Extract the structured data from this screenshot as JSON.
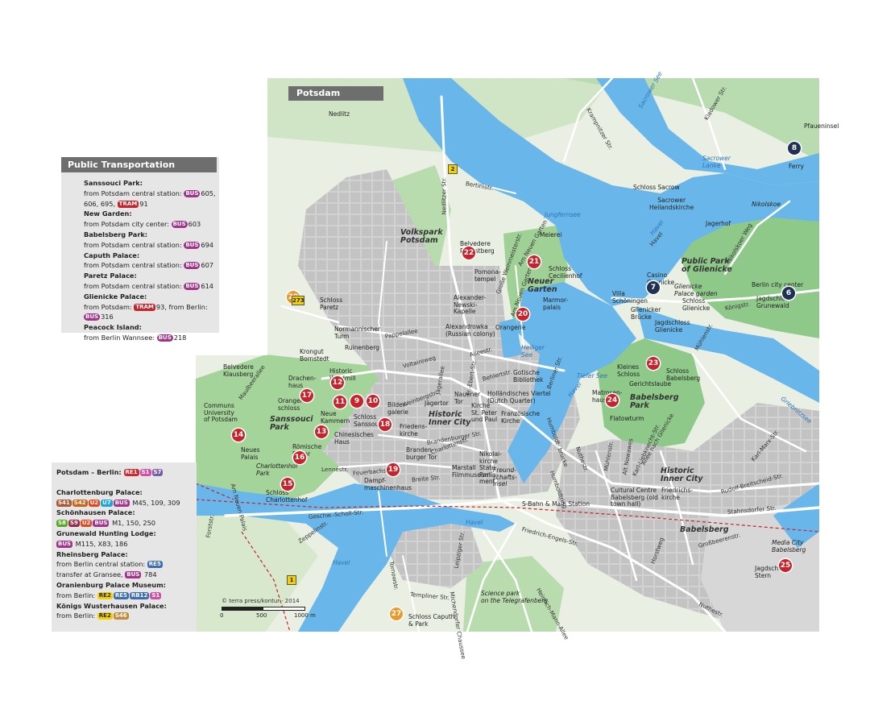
{
  "map_title": "Potsdam",
  "public_transport": {
    "header": "Public Transportation",
    "entries": [
      {
        "title": "Sanssouci Park:",
        "text": "from Potsdam central station:",
        "badges": [
          {
            "kind": "bus",
            "label": "BUS"
          }
        ],
        "routes": "605, 606, 695,",
        "badges2": [
          {
            "kind": "tram",
            "label": "TRAM"
          }
        ],
        "routes2": "91"
      },
      {
        "title": "New Garden:",
        "text": "from Potsdam city center:",
        "badges": [
          {
            "kind": "bus",
            "label": "BUS"
          }
        ],
        "routes": "603"
      },
      {
        "title": "Babelsberg Park:",
        "text": "from Potsdam central station:",
        "badges": [
          {
            "kind": "bus",
            "label": "BUS"
          }
        ],
        "routes": "694"
      },
      {
        "title": "Caputh Palace:",
        "text": "from Potsdam central station:",
        "badges": [
          {
            "kind": "bus",
            "label": "BUS"
          }
        ],
        "routes": "607"
      },
      {
        "title": "Paretz Palace:",
        "text": "from Potsdam central station:",
        "badges": [
          {
            "kind": "bus",
            "label": "BUS"
          }
        ],
        "routes": "614"
      },
      {
        "title": "Glienicke Palace:",
        "text": "from Potsdam:",
        "badges": [
          {
            "kind": "tram",
            "label": "TRAM"
          }
        ],
        "routes": "93, from Berlin:",
        "badges2": [
          {
            "kind": "bus",
            "label": "BUS"
          }
        ],
        "routes2": "316"
      },
      {
        "title": "Peacock Island:",
        "text": "from Berlin Wannsee:",
        "badges": [
          {
            "kind": "bus",
            "label": "BUS"
          }
        ],
        "routes": "218"
      }
    ]
  },
  "berlin_box": {
    "title": "Potsdam – Berlin:",
    "title_badges": [
      {
        "label": "RE1",
        "color": "#d7262e"
      },
      {
        "label": "S1",
        "color": "#d24fa8"
      },
      {
        "label": "S7",
        "color": "#7b5ca8"
      }
    ],
    "entries": [
      {
        "title": "Charlottenburg Palace:",
        "lines": [
          {
            "badges": [
              {
                "label": "S41",
                "color": "#ad5937"
              },
              {
                "label": "S42",
                "color": "#cb6418"
              },
              {
                "label": "U2",
                "color": "#e4461d"
              },
              {
                "label": "U7",
                "color": "#1ba5dc"
              },
              {
                "label": "BUS",
                "color": "#a3328a"
              }
            ],
            "text": "M45, 109, 309"
          }
        ]
      },
      {
        "title": "Schönhausen Palace:",
        "lines": [
          {
            "badges": [
              {
                "label": "S8",
                "color": "#55a822"
              },
              {
                "label": "S9",
                "color": "#992746"
              },
              {
                "label": "U2",
                "color": "#e4461d"
              },
              {
                "label": "BUS",
                "color": "#a3328a"
              }
            ],
            "text": "M1, 150, 250"
          }
        ]
      },
      {
        "title": "Grunewald Hunting Lodge:",
        "lines": [
          {
            "badges": [
              {
                "label": "BUS",
                "color": "#a3328a"
              }
            ],
            "text": "M115, X83, 186"
          }
        ]
      },
      {
        "title": "Rheinsberg Palace:",
        "lines": [
          {
            "badges": [],
            "text": "from Berlin central station:",
            "badges_after": [
              {
                "label": "RE5",
                "color": "#3b6bb3"
              }
            ]
          },
          {
            "badges": [],
            "text": "transfer at Gransee,",
            "badges_after": [
              {
                "label": "BUS",
                "color": "#a3328a"
              }
            ],
            "text_after": "784"
          }
        ]
      },
      {
        "title": "Oranienburg Palace Museum:",
        "lines": [
          {
            "badges": [],
            "text": "from Berlin:",
            "badges_after": [
              {
                "label": "RE2",
                "color": "#f2d100",
                "fg": "#222"
              },
              {
                "label": "RE5",
                "color": "#3b6bb3"
              },
              {
                "label": "RB12",
                "color": "#3b6bb3"
              },
              {
                "label": "S1",
                "color": "#d24fa8"
              }
            ]
          }
        ]
      },
      {
        "title": "Königs Wusterhausen Palace:",
        "lines": [
          {
            "badges": [],
            "text": "from Berlin:",
            "badges_after": [
              {
                "label": "RE2",
                "color": "#f2d100",
                "fg": "#222"
              },
              {
                "label": "S46",
                "color": "#c38a3a"
              }
            ]
          }
        ]
      }
    ]
  },
  "credit": "© terra press/kontur · 2014",
  "scale": {
    "zero": "0",
    "mid": "500",
    "end": "1000 m"
  },
  "areas": [
    {
      "id": "nedlitz",
      "text": "Nedlitz"
    },
    {
      "id": "volkspark",
      "text": "Volkspark\nPotsdam"
    },
    {
      "id": "neuer-garten",
      "text": "Neuer\nGarten"
    },
    {
      "id": "sanssouci-park",
      "text": "Sanssouci\nPark"
    },
    {
      "id": "babelsberg-park",
      "text": "Babelsberg\nPark"
    },
    {
      "id": "public-park-glienicke",
      "text": "Public Park\nof Glienicke"
    },
    {
      "id": "historic-inner-city",
      "text": "Historic\nInner City"
    },
    {
      "id": "historic-inner-city-2",
      "text": "Historic\nInner City"
    },
    {
      "id": "babelsberg",
      "text": "Babelsberg"
    },
    {
      "id": "charlottenhof-park",
      "text": "Charlottenhof\nPark"
    },
    {
      "id": "science-park",
      "text": "Science park\non the Telegrafenberg"
    },
    {
      "id": "media-city",
      "text": "Media City\nBabelsberg"
    }
  ],
  "waters": [
    {
      "id": "jungfernsee",
      "text": "Jungfernsee"
    },
    {
      "id": "sacrower-see",
      "text": "Sacrower See"
    },
    {
      "id": "sacrower-lanke",
      "text": "Sacrower\nLanke"
    },
    {
      "id": "heiliger-see",
      "text": "Heiliger\nSee"
    },
    {
      "id": "tiefer-see",
      "text": "Tiefer See"
    },
    {
      "id": "havel-1",
      "text": "Havel"
    },
    {
      "id": "havel-2",
      "text": "Havel"
    },
    {
      "id": "havel-3",
      "text": "Havel"
    },
    {
      "id": "havel-4",
      "text": "Havel"
    },
    {
      "id": "griebnitzsee",
      "text": "Griebnitzsee"
    }
  ],
  "places": [
    {
      "id": "schloss-sacrow",
      "text": "Schloss Sacrow"
    },
    {
      "id": "heilandskirche",
      "text": "Sacrower\nHeilandskirche"
    },
    {
      "id": "pfaueninsel",
      "text": "Pfaueninsel"
    },
    {
      "id": "ferry",
      "text": "Ferry"
    },
    {
      "id": "nikolskoe",
      "text": "Nikolskoe"
    },
    {
      "id": "jagerhof",
      "text": "Jagerhof"
    },
    {
      "id": "casino",
      "text": "Casino\nGlienicke"
    },
    {
      "id": "glienicke-palace-garden",
      "text": "Glienicke\nPalace garden"
    },
    {
      "id": "schloss-glienicke",
      "text": "Schloss\nGlienicke"
    },
    {
      "id": "jagdschloss-glienicke",
      "text": "Jagdschloss\nGlienicke"
    },
    {
      "id": "villa-schoningen",
      "text": "Villa\nSchöningen"
    },
    {
      "id": "glienicker-brucke",
      "text": "Glienicker\nBrücke"
    },
    {
      "id": "berlin-city-center",
      "text": "Berlin city center"
    },
    {
      "id": "jagdschloss-grunewald",
      "text": "Jagdschloss\nGrunewald"
    },
    {
      "id": "meierei",
      "text": "Meierei"
    },
    {
      "id": "belvedere-pfingstberg",
      "text": "Belvedere\nPfingstberg"
    },
    {
      "id": "pomonatempel",
      "text": "Pomona-\ntempel"
    },
    {
      "id": "schloss-cecilienhof",
      "text": "Schloss\nCecilienhof"
    },
    {
      "id": "marmorpalais",
      "text": "Marmor-\npalais"
    },
    {
      "id": "orangerie-ng",
      "text": "Orangerie"
    },
    {
      "id": "alexander-newski",
      "text": "Alexander-\nNewski-\nKapelle"
    },
    {
      "id": "alexandrowka",
      "text": "Alexandrowka\n(Russian colony)"
    },
    {
      "id": "schloss-paretz",
      "text": "Schloss\nParetz"
    },
    {
      "id": "normannischer-turm",
      "text": "Normannischer\nTurm"
    },
    {
      "id": "ruinenberg",
      "text": "Ruinenberg"
    },
    {
      "id": "krongut",
      "text": "Krongut\nBornstedt"
    },
    {
      "id": "belvedere-klausberg",
      "text": "Belvedere\nKlausberg"
    },
    {
      "id": "drachenhaus",
      "text": "Drachen-\nhaus"
    },
    {
      "id": "orangerieschloss",
      "text": "Orangerie-\nschloss"
    },
    {
      "id": "historic-windmill",
      "text": "Historic\nWindmill"
    },
    {
      "id": "communs",
      "text": "Communs\nUniversity\nof Potsdam"
    },
    {
      "id": "neue-kammern",
      "text": "Neue\nKammern"
    },
    {
      "id": "schloss-sanssouci",
      "text": "Schloss\nSanssouci"
    },
    {
      "id": "bildergalerie",
      "text": "Bilder-\ngalerie"
    },
    {
      "id": "chinesisches-haus",
      "text": "Chinesisches\nHaus"
    },
    {
      "id": "roemische-bader",
      "text": "Römische\nBäder"
    },
    {
      "id": "neues-palais",
      "text": "Neues\nPalais"
    },
    {
      "id": "schloss-charlottenhof",
      "text": "Schloss\nCharlottenhof"
    },
    {
      "id": "friedenskirche",
      "text": "Friedens-\nkirche"
    },
    {
      "id": "brandenburger-tor",
      "text": "Branden-\nburger Tor"
    },
    {
      "id": "jagertor",
      "text": "Jägertor"
    },
    {
      "id": "nauener-tor",
      "text": "Nauener\nTor"
    },
    {
      "id": "hollandisches",
      "text": "Holländisches Viertel\n(Dutch Quarter)"
    },
    {
      "id": "kirche-peter-paul",
      "text": "Kirche\nSt. Peter\nund Paul"
    },
    {
      "id": "franzosische-kirche",
      "text": "Französische\nKirche"
    },
    {
      "id": "gotische-bibliothek",
      "text": "Gotische\nBibliothek"
    },
    {
      "id": "nikolaikirche",
      "text": "Nikolai-\nkirche\nState\nParlia-\nment"
    },
    {
      "id": "marstall",
      "text": "Marstall\nFilmmuseum"
    },
    {
      "id": "dampfmaschinenhaus",
      "text": "Dampf-\nmaschinenhaus"
    },
    {
      "id": "sbahn-main",
      "text": "S-Bahn & Main Station"
    },
    {
      "id": "kleines-schloss",
      "text": "Kleines\nSchloss"
    },
    {
      "id": "schloss-babelsberg",
      "text": "Schloss\nBabelsberg"
    },
    {
      "id": "gerichtslaube",
      "text": "Gerichtslaube"
    },
    {
      "id": "matrosenhaus",
      "text": "Matrosen-\nhaus"
    },
    {
      "id": "flatowturm",
      "text": "Flatowturm"
    },
    {
      "id": "cultural-centre",
      "text": "Cultural Centre\nBabelsberg (old\ntown hall)"
    },
    {
      "id": "friedrichskirche",
      "text": "Friedrichs-\nkirche"
    },
    {
      "id": "jagdschloss-stern",
      "text": "Jagdschloss\nStern"
    },
    {
      "id": "schloss-caputh",
      "text": "Schloss Caputh\n& Park"
    },
    {
      "id": "freundschaftsinsel",
      "text": "Freund-\nschafts-\ninsel"
    }
  ],
  "streets": [
    {
      "id": "krampnitzer",
      "text": "Krampnitzer Str."
    },
    {
      "id": "kladower",
      "text": "Kladower Str."
    },
    {
      "id": "bertinistr",
      "text": "Bertinistr."
    },
    {
      "id": "nedlitzer",
      "text": "Nedlitzer Str."
    },
    {
      "id": "weinmeisterstr",
      "text": "Große Weinmeisterstr."
    },
    {
      "id": "am-neuen-garten",
      "text": "Am Neuen Garten"
    },
    {
      "id": "am-neuen-garten-2",
      "text": "Am Neuen Garten"
    },
    {
      "id": "pappelallee",
      "text": "Pappelallee"
    },
    {
      "id": "voltaireweg",
      "text": "Voltaireweg"
    },
    {
      "id": "jagerallee",
      "text": "Jägerallee"
    },
    {
      "id": "alleestr",
      "text": "Alleestr."
    },
    {
      "id": "ebertstr",
      "text": "Fr.-Ebert-Str."
    },
    {
      "id": "behlertstr",
      "text": "Behlertstr."
    },
    {
      "id": "berliner-str",
      "text": "Berliner Str."
    },
    {
      "id": "weinbergstr",
      "text": "Weinbergstr."
    },
    {
      "id": "maulbeerallee",
      "text": "Maulbeerallee"
    },
    {
      "id": "brandenburger-str",
      "text": "Brandenburger Str."
    },
    {
      "id": "charlottenstr",
      "text": "Charlottenstr."
    },
    {
      "id": "lennestr",
      "text": "Lennéstr."
    },
    {
      "id": "feuerbachstr",
      "text": "Feuerbachstr."
    },
    {
      "id": "breite-str",
      "text": "Breite Str."
    },
    {
      "id": "geschw-scholl",
      "text": "Geschw.-Scholl-Str."
    },
    {
      "id": "zeppelinstr",
      "text": "Zeppelinstr."
    },
    {
      "id": "forststr",
      "text": "Forststr."
    },
    {
      "id": "tornowstr",
      "text": "Tornowstr."
    },
    {
      "id": "leipziger",
      "text": "Leipziger Str."
    },
    {
      "id": "templiner",
      "text": "Templiner Str."
    },
    {
      "id": "michendorfer",
      "text": "Michendorfer Chaussee"
    },
    {
      "id": "heinrich-mann",
      "text": "Heinrich-Mann-Allee"
    },
    {
      "id": "friedrich-engels",
      "text": "Friedrich-Engels-Str."
    },
    {
      "id": "humboldtring",
      "text": "Humboldtring"
    },
    {
      "id": "humboldtbrucke",
      "text": "Humboldt-\nbrücke"
    },
    {
      "id": "nuthestr",
      "text": "Nuthestr."
    },
    {
      "id": "muhlenstr",
      "text": "Mühlenstr."
    },
    {
      "id": "alt-nowawes",
      "text": "Alt Nowawes"
    },
    {
      "id": "karl-liebknecht",
      "text": "Karl-Liebknecht-Str."
    },
    {
      "id": "allee-glienicke",
      "text": "Allee nach Glienicke"
    },
    {
      "id": "karl-marx",
      "text": "Karl-Marx-Str."
    },
    {
      "id": "rudolf-breitscheid",
      "text": "Rudolf-Breitscheid-Str."
    },
    {
      "id": "stahnsdorfer",
      "text": "Stahnsdorfer Str."
    },
    {
      "id": "grossbeerenstr",
      "text": "Großbeerenstr."
    },
    {
      "id": "horstweg",
      "text": "Horstweg"
    },
    {
      "id": "nuthestr-2",
      "text": "Nuthestr."
    },
    {
      "id": "konigstr",
      "text": "Königstr."
    },
    {
      "id": "nikolskoer-weg",
      "text": "Nikolskoer Weg"
    },
    {
      "id": "muhlenstr-glienicke",
      "text": "Mühlenstr."
    },
    {
      "id": "havel-glienicke",
      "text": "Havel"
    },
    {
      "id": "an-neuen-palais",
      "text": "Am Neuen Palais"
    }
  ],
  "markers": [
    {
      "n": "6",
      "color": "#1f3256"
    },
    {
      "n": "7",
      "color": "#1f3256"
    },
    {
      "n": "8",
      "color": "#1f3256"
    },
    {
      "n": "9",
      "color": "#c8222b"
    },
    {
      "n": "10",
      "color": "#c8222b"
    },
    {
      "n": "11",
      "color": "#c8222b"
    },
    {
      "n": "12",
      "color": "#c8222b"
    },
    {
      "n": "13",
      "color": "#c8222b"
    },
    {
      "n": "14",
      "color": "#c8222b"
    },
    {
      "n": "15",
      "color": "#c8222b"
    },
    {
      "n": "16",
      "color": "#c8222b"
    },
    {
      "n": "17",
      "color": "#c8222b"
    },
    {
      "n": "18",
      "color": "#c8222b"
    },
    {
      "n": "19",
      "color": "#c8222b"
    },
    {
      "n": "20",
      "color": "#c8222b"
    },
    {
      "n": "21",
      "color": "#c8222b"
    },
    {
      "n": "22",
      "color": "#c8222b"
    },
    {
      "n": "23",
      "color": "#c8222b"
    },
    {
      "n": "24",
      "color": "#c8222b"
    },
    {
      "n": "25",
      "color": "#c8222b"
    },
    {
      "n": "27",
      "color": "#e99a2c"
    },
    {
      "n": "29",
      "color": "#e99a2c"
    }
  ],
  "route_signs": {
    "b273": "273",
    "b2": "2",
    "b1": "1"
  },
  "colors": {
    "water": "#69b7ea",
    "park": "#b9dcae",
    "forest": "#8fc98a",
    "urban": "#c9c9c9",
    "street": "#ffffff",
    "base": "#e9efe3",
    "panel": "#e6e6e6"
  }
}
